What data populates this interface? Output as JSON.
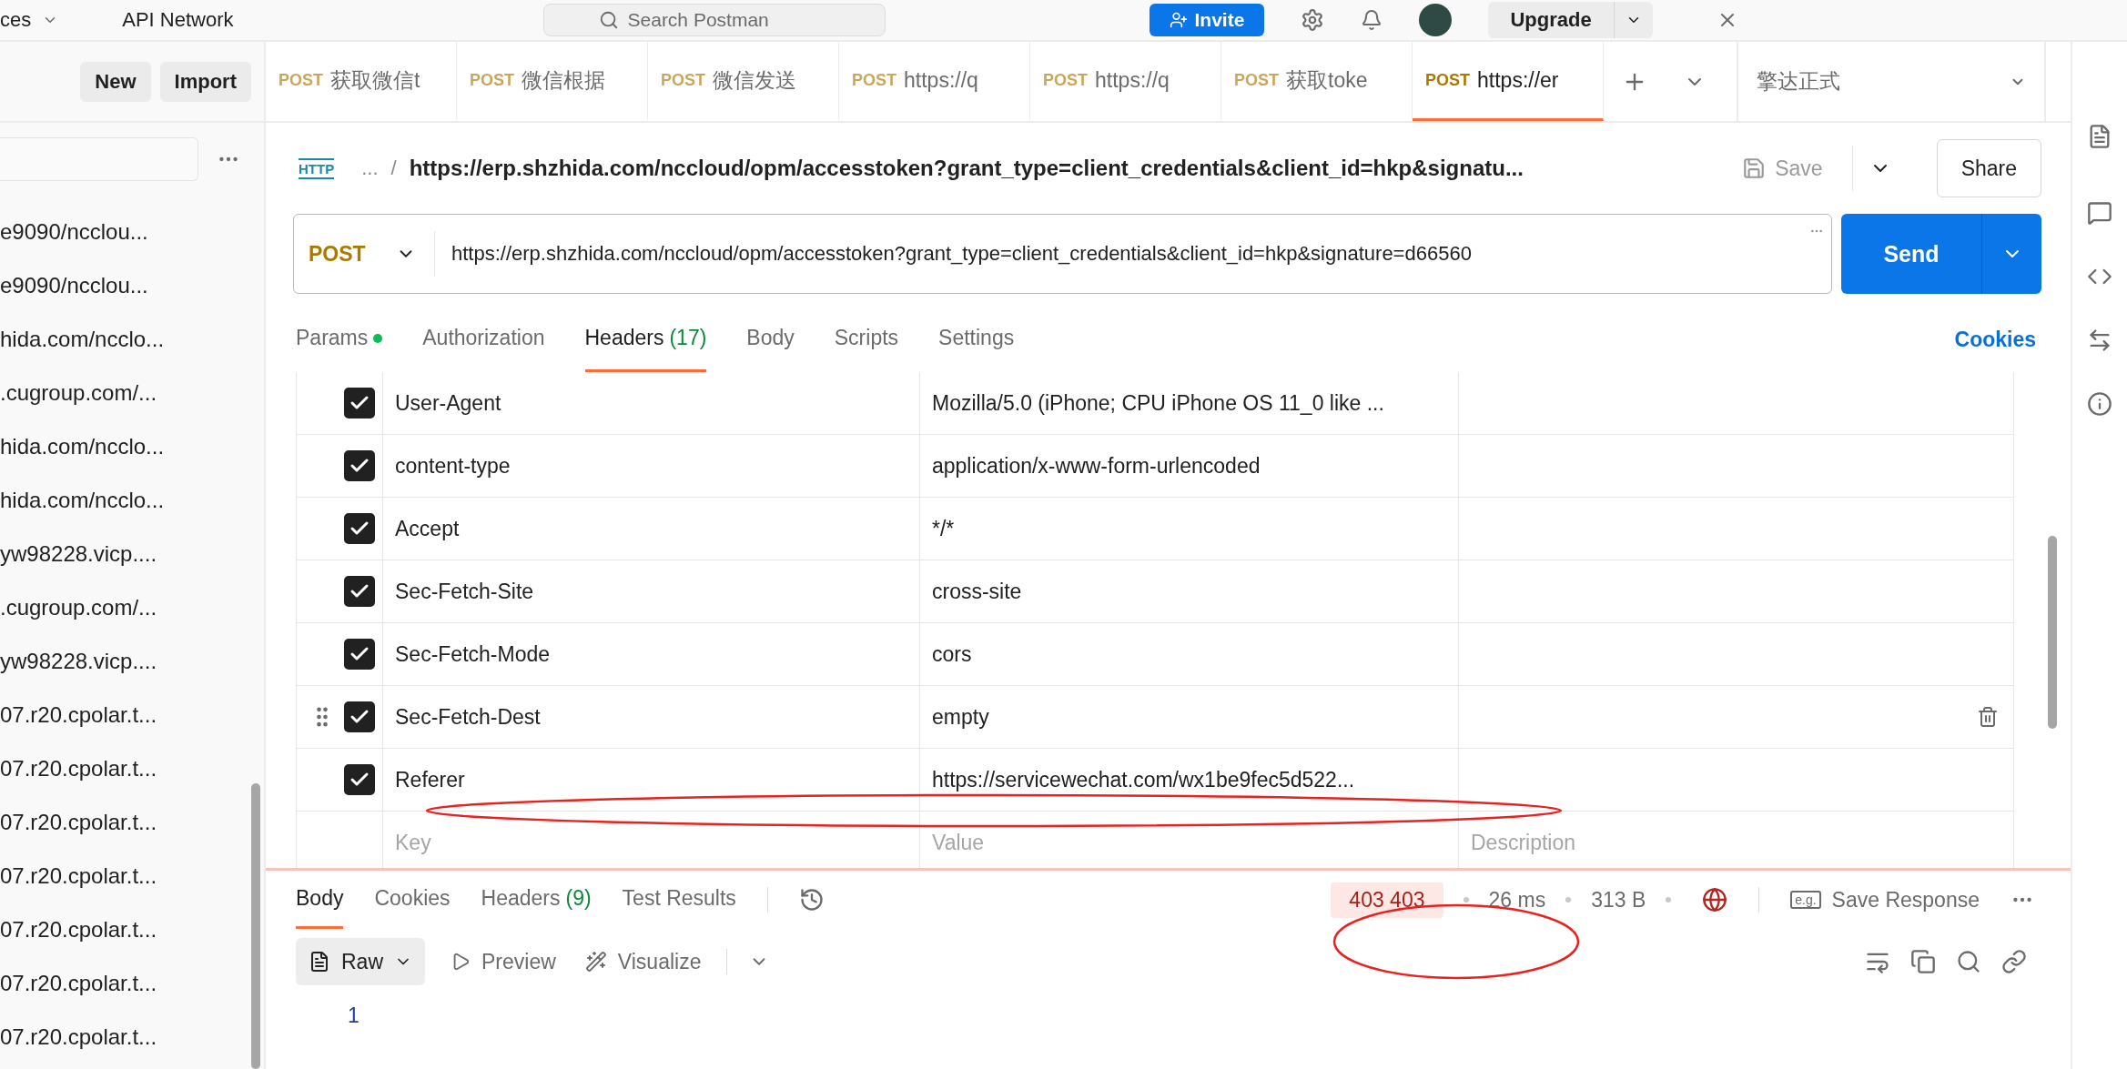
{
  "top_bar": {
    "workspaces": "ces",
    "api_network": "API Network",
    "search_placeholder": "Search Postman",
    "invite": "Invite",
    "upgrade": "Upgrade"
  },
  "sidebar": {
    "buttons": [
      "New",
      "Import"
    ],
    "items": [
      "e9090/ncclou...",
      "e9090/ncclou...",
      "hida.com/ncclo...",
      ".cugroup.com/...",
      "hida.com/ncclo...",
      "hida.com/ncclo...",
      "yw98228.vicp....",
      ".cugroup.com/...",
      "yw98228.vicp....",
      "07.r20.cpolar.t...",
      "07.r20.cpolar.t...",
      "07.r20.cpolar.t...",
      "07.r20.cpolar.t...",
      "07.r20.cpolar.t...",
      "07.r20.cpolar.t...",
      "07.r20.cpolar.t..."
    ]
  },
  "tabs": [
    {
      "method": "POST",
      "label": "获取微信t",
      "selected": false
    },
    {
      "method": "POST",
      "label": "微信根据",
      "selected": false
    },
    {
      "method": "POST",
      "label": "微信发送",
      "selected": false
    },
    {
      "method": "POST",
      "label": "https://q",
      "selected": false
    },
    {
      "method": "POST",
      "label": "https://q",
      "selected": false
    },
    {
      "method": "POST",
      "label": "获取toke",
      "selected": false
    },
    {
      "method": "POST",
      "label": "https://er",
      "selected": true
    }
  ],
  "environment": "擎达正式",
  "request": {
    "icon_label": "HTTP",
    "breadcrumb": "...",
    "separator": "/",
    "title": "https://erp.shzhida.com/nccloud/opm/accesstoken?grant_type=client_credentials&client_id=hkp&signatu...",
    "save": "Save",
    "share": "Share",
    "method": "POST",
    "url": "https://erp.shzhida.com/nccloud/opm/accesstoken?grant_type=client_credentials&client_id=hkp&signature=d66560",
    "send": "Send"
  },
  "request_tabs": [
    {
      "label": "Params",
      "indicator": true,
      "selected": false
    },
    {
      "label": "Authorization",
      "indicator": false,
      "selected": false
    },
    {
      "label": "Headers",
      "count": "(17)",
      "indicator": false,
      "selected": true
    },
    {
      "label": "Body",
      "indicator": false,
      "selected": false
    },
    {
      "label": "Scripts",
      "indicator": false,
      "selected": false
    },
    {
      "label": "Settings",
      "indicator": false,
      "selected": false
    }
  ],
  "cookies_link": "Cookies",
  "headers": {
    "rows": [
      {
        "key": "User-Agent",
        "value": "Mozilla/5.0 (iPhone; CPU iPhone OS 11_0 like ...",
        "checked": true,
        "hovered": false
      },
      {
        "key": "content-type",
        "value": "application/x-www-form-urlencoded",
        "checked": true,
        "hovered": false
      },
      {
        "key": "Accept",
        "value": "*/*",
        "checked": true,
        "hovered": false
      },
      {
        "key": "Sec-Fetch-Site",
        "value": "cross-site",
        "checked": true,
        "hovered": false
      },
      {
        "key": "Sec-Fetch-Mode",
        "value": "cors",
        "checked": true,
        "hovered": false
      },
      {
        "key": "Sec-Fetch-Dest",
        "value": "empty",
        "checked": true,
        "hovered": true
      },
      {
        "key": "Referer",
        "value": "https://servicewechat.com/wx1be9fec5d522...",
        "checked": true,
        "hovered": false
      }
    ],
    "placeholder": {
      "key": "Key",
      "value": "Value",
      "description": "Description"
    }
  },
  "response": {
    "tabs": [
      {
        "label": "Body",
        "selected": true
      },
      {
        "label": "Cookies",
        "selected": false
      },
      {
        "label": "Headers",
        "count": "(9)",
        "selected": false
      },
      {
        "label": "Test Results",
        "selected": false
      }
    ],
    "status": "403 403",
    "time": "26 ms",
    "size": "313 B",
    "save_icon": "e.g.",
    "save_response": "Save Response",
    "format": "Raw",
    "preview": "Preview",
    "visualize": "Visualize",
    "line_number": "1"
  }
}
